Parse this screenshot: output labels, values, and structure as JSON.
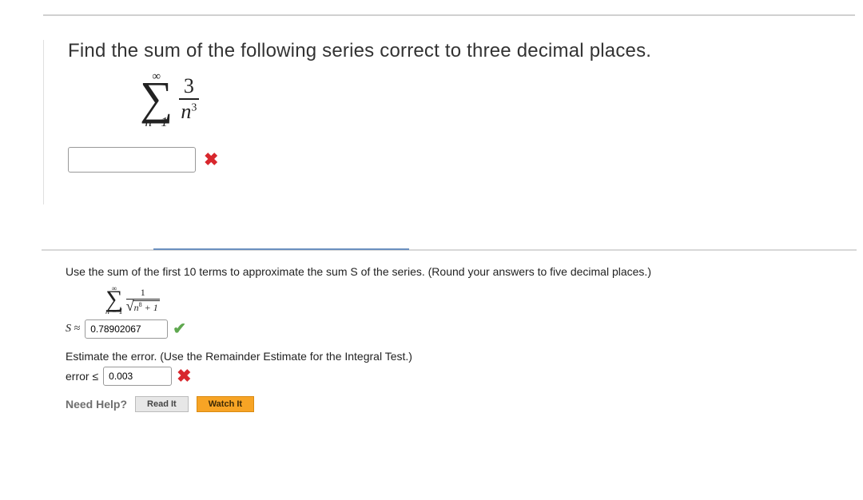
{
  "q1": {
    "prompt": "Find the sum of the following following series correct to three decimal places.",
    "prompt_fixed": "Find the sum of the following series correct to three decimal places.",
    "sigma_upper": "∞",
    "sigma_lower": "n=1",
    "frac_num": "3",
    "frac_den_base": "n",
    "frac_den_exp": "3",
    "answer_value": "",
    "status": "wrong"
  },
  "q2": {
    "prompt": "Use the sum of the first 10 terms to approximate the sum S of the series. (Round your answers to five decimal places.)",
    "sigma_upper": "∞",
    "sigma_lower": "n = 1",
    "frac_num": "1",
    "radicand_base": "n",
    "radicand_exp": "8",
    "radicand_rest": " + 1",
    "s_label": "S ≈",
    "s_value": "0.78902067",
    "s_status": "right",
    "estimate_text": "Estimate the error. (Use the Remainder Estimate for the Integral Test.)",
    "error_label": "error ≤",
    "error_value": "0.003",
    "error_status": "wrong"
  },
  "help": {
    "label": "Need Help?",
    "read": "Read It",
    "watch": "Watch It"
  },
  "marks": {
    "wrong": "✖",
    "right": "✔"
  }
}
